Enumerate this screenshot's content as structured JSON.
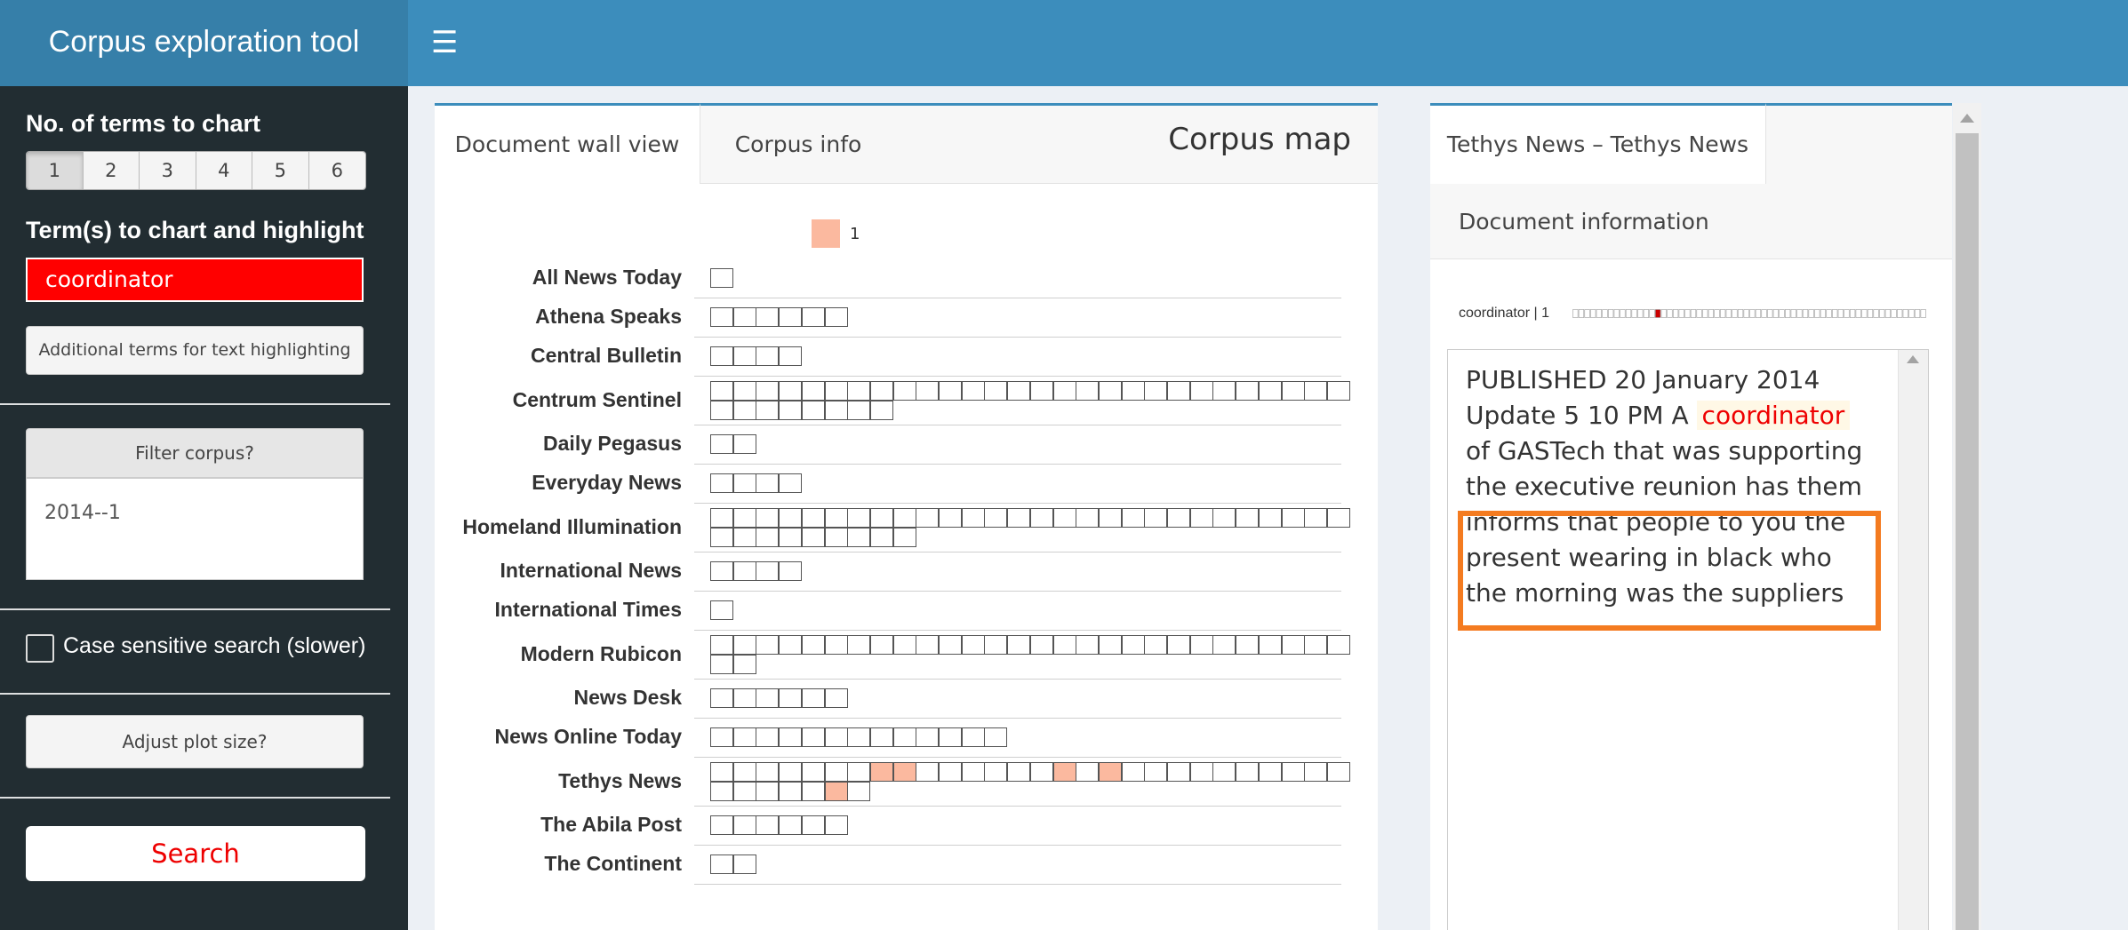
{
  "app": {
    "title": "Corpus exploration tool",
    "menu_icon": "hamburger-icon"
  },
  "sidebar": {
    "terms_count_label": "No. of terms to chart",
    "term_count_options": [
      "1",
      "2",
      "3",
      "4",
      "5",
      "6"
    ],
    "term_count_selected": "1",
    "terms_label": "Term(s) to chart and highlight",
    "terms_value": "coordinator",
    "additional_terms_button": "Additional terms for text highlighting",
    "filter_button": "Filter corpus?",
    "filter_value": "2014--1",
    "case_sensitive_label": "Case sensitive search (slower)",
    "case_sensitive_checked": false,
    "adjust_button": "Adjust plot size?",
    "search_button": "Search"
  },
  "main": {
    "tabs": [
      {
        "label": "Document wall view",
        "active": true
      },
      {
        "label": "Corpus info",
        "active": false
      }
    ],
    "title": "Corpus map",
    "legend": {
      "label": "1",
      "color": "#fbb99f"
    },
    "rows": [
      {
        "name": "All News Today",
        "docs": 1,
        "highlighted": []
      },
      {
        "name": "Athena Speaks",
        "docs": 6,
        "highlighted": []
      },
      {
        "name": "Central Bulletin",
        "docs": 4,
        "highlighted": []
      },
      {
        "name": "Centrum Sentinel",
        "docs": 36,
        "highlighted": []
      },
      {
        "name": "Daily Pegasus",
        "docs": 2,
        "highlighted": []
      },
      {
        "name": "Everyday News",
        "docs": 4,
        "highlighted": []
      },
      {
        "name": "Homeland Illumination",
        "docs": 37,
        "highlighted": []
      },
      {
        "name": "International News",
        "docs": 4,
        "highlighted": []
      },
      {
        "name": "International Times",
        "docs": 1,
        "highlighted": []
      },
      {
        "name": "Modern Rubicon",
        "docs": 30,
        "highlighted": []
      },
      {
        "name": "News Desk",
        "docs": 6,
        "highlighted": []
      },
      {
        "name": "News Online Today",
        "docs": 13,
        "highlighted": []
      },
      {
        "name": "Tethys News",
        "docs": 35,
        "highlighted": [
          7,
          8,
          15,
          17,
          33
        ]
      },
      {
        "name": "The Abila Post",
        "docs": 6,
        "highlighted": []
      },
      {
        "name": "The Continent",
        "docs": 2,
        "highlighted": []
      }
    ]
  },
  "doc_panel": {
    "tabs": [
      {
        "label": "Tethys News – Tethys News",
        "active": true
      },
      {
        "label": "Document information",
        "active": false
      }
    ],
    "mini_chart_label": "coordinator | 1",
    "mini_chart": {
      "segments": 60,
      "highlight_index": 14,
      "highlight_color": "#cc0000"
    },
    "text_before": "PUBLISHED 20 January 2014 Update 5 10 PM A ",
    "keyword": "coordinator",
    "text_after": " of GASTech that was supporting the executive reunion has them informs that people to you the present wearing in black who the morning was the suppliers",
    "annotation_color": "#f47b20"
  }
}
